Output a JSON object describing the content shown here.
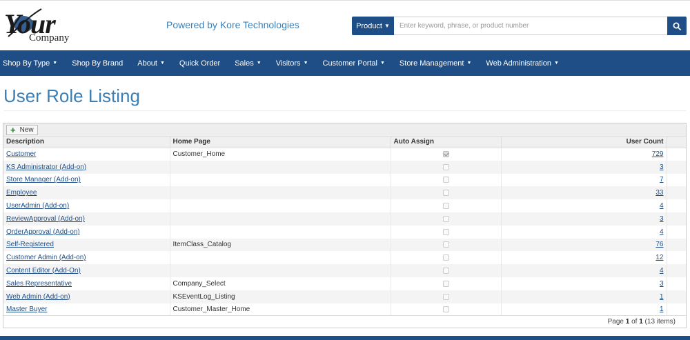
{
  "header": {
    "logo_your": "Your",
    "logo_company": "Company",
    "powered_by": "Powered by Kore Technologies",
    "search": {
      "category": "Product",
      "placeholder": "Enter keyword, phrase, or product number",
      "icon": "search-icon"
    }
  },
  "nav": {
    "items": [
      {
        "label": "Shop By Type",
        "dropdown": true
      },
      {
        "label": "Shop By Brand",
        "dropdown": false
      },
      {
        "label": "About",
        "dropdown": true
      },
      {
        "label": "Quick Order",
        "dropdown": false
      },
      {
        "label": "Sales",
        "dropdown": true
      },
      {
        "label": "Visitors",
        "dropdown": true
      },
      {
        "label": "Customer Portal",
        "dropdown": true
      },
      {
        "label": "Store Management",
        "dropdown": true
      },
      {
        "label": "Web Administration",
        "dropdown": true
      }
    ]
  },
  "page": {
    "title": "User Role Listing"
  },
  "grid": {
    "new_label": "New",
    "columns": {
      "description": "Description",
      "home_page": "Home Page",
      "auto_assign": "Auto Assign",
      "user_count": "User Count"
    },
    "rows": [
      {
        "description": "Customer",
        "home_page": "Customer_Home",
        "auto_assign": true,
        "user_count": "729"
      },
      {
        "description": "KS Administrator (Add-on)",
        "home_page": "",
        "auto_assign": false,
        "user_count": "3"
      },
      {
        "description": "Store Manager (Add-on)",
        "home_page": "",
        "auto_assign": false,
        "user_count": "7"
      },
      {
        "description": "Employee",
        "home_page": "",
        "auto_assign": false,
        "user_count": "33"
      },
      {
        "description": "UserAdmin (Add-on)",
        "home_page": "",
        "auto_assign": false,
        "user_count": "4"
      },
      {
        "description": "ReviewApproval (Add-on)",
        "home_page": "",
        "auto_assign": false,
        "user_count": "3"
      },
      {
        "description": "OrderApproval (Add-on)",
        "home_page": "",
        "auto_assign": false,
        "user_count": "4"
      },
      {
        "description": "Self-Registered",
        "home_page": "ItemClass_Catalog",
        "auto_assign": false,
        "user_count": "76"
      },
      {
        "description": "Customer Admin (Add-on)",
        "home_page": "",
        "auto_assign": false,
        "user_count": "12"
      },
      {
        "description": "Content Editor (Add-On)",
        "home_page": "",
        "auto_assign": false,
        "user_count": "4"
      },
      {
        "description": "Sales Representative",
        "home_page": "Company_Select",
        "auto_assign": false,
        "user_count": "3"
      },
      {
        "description": "Web Admin (Add-on)",
        "home_page": "KSEventLog_Listing",
        "auto_assign": false,
        "user_count": "1"
      },
      {
        "description": "Master Buyer",
        "home_page": "Customer_Master_Home",
        "auto_assign": false,
        "user_count": "1"
      }
    ],
    "pager": {
      "prefix": "Page",
      "page": "1",
      "of_label": "of",
      "total_pages": "1",
      "items_text": "(13 items)"
    }
  },
  "colors": {
    "brand": "#1f4e86",
    "title": "#3c7fb5",
    "link": "#1f4e86"
  }
}
